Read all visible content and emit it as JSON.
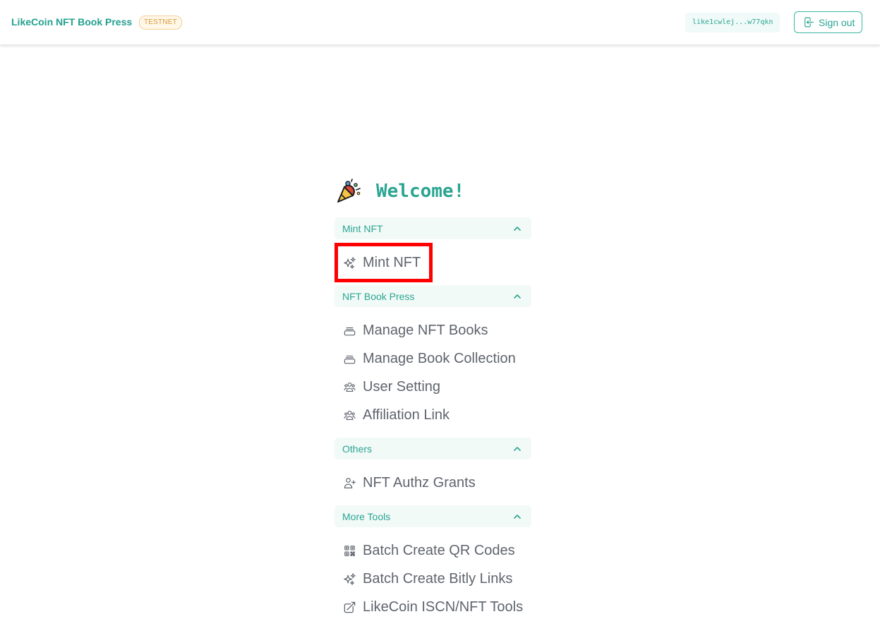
{
  "header": {
    "brand": "LikeCoin NFT Book Press",
    "badge": "TESTNET",
    "address": "like1cwlej...w77qkn",
    "sign_out": "Sign out"
  },
  "welcome": {
    "emoji": "party-popper-icon",
    "title": "Welcome!"
  },
  "sections": [
    {
      "title": "Mint NFT",
      "items": [
        {
          "label": "Mint NFT",
          "icon": "sparkles-icon"
        }
      ]
    },
    {
      "title": "NFT Book Press",
      "items": [
        {
          "label": "Manage NFT Books",
          "icon": "book-stack-icon"
        },
        {
          "label": "Manage Book Collection",
          "icon": "book-stack-icon"
        },
        {
          "label": "User Setting",
          "icon": "users-icon"
        },
        {
          "label": "Affiliation Link",
          "icon": "users-icon"
        }
      ]
    },
    {
      "title": "Others",
      "items": [
        {
          "label": "NFT Authz Grants",
          "icon": "user-plus-icon"
        }
      ]
    },
    {
      "title": "More Tools",
      "items": [
        {
          "label": "Batch Create QR Codes",
          "icon": "qr-code-icon"
        },
        {
          "label": "Batch Create Bitly Links",
          "icon": "sparkles-icon"
        },
        {
          "label": "LikeCoin ISCN/NFT Tools",
          "icon": "external-link-icon"
        }
      ]
    }
  ],
  "colors": {
    "accent": "#2aa592",
    "section_bg": "#f2faf7",
    "highlight": "#ff0000"
  }
}
